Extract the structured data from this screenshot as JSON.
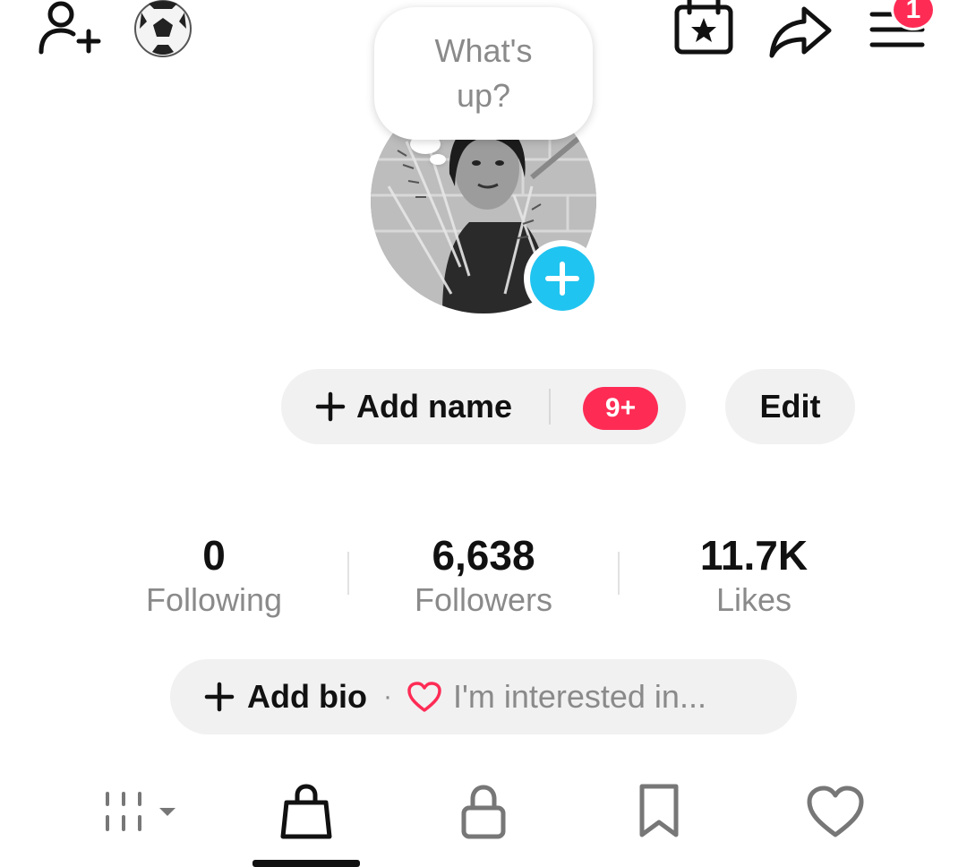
{
  "top_bar": {
    "icons": [
      "add-friend-icon",
      "soccer-ball-icon",
      "calendar-star-icon",
      "share-icon",
      "menu-icon"
    ],
    "menu_badge": "1"
  },
  "avatar": {
    "bubble_text": "What's up?"
  },
  "actions": {
    "add_name_label": "Add name",
    "notification_badge": "9+",
    "edit_label": "Edit"
  },
  "stats": [
    {
      "value": "0",
      "label": "Following"
    },
    {
      "value": "6,638",
      "label": "Followers"
    },
    {
      "value": "11.7K",
      "label": "Likes"
    }
  ],
  "bio": {
    "add_bio_label": "Add bio",
    "separator": "·",
    "interest_text": "I'm interested in..."
  },
  "tabs": [
    {
      "icon": "grid-icon",
      "selected": false
    },
    {
      "icon": "shopping-bag-icon",
      "selected": true
    },
    {
      "icon": "lock-icon",
      "selected": false
    },
    {
      "icon": "bookmark-icon",
      "selected": false
    },
    {
      "icon": "heart-icon",
      "selected": false
    }
  ],
  "colors": {
    "accent_red": "#fe2c55",
    "add_blue": "#20c4f0",
    "pill_bg": "#f1f1f2",
    "muted_text": "#8a8a8a"
  }
}
